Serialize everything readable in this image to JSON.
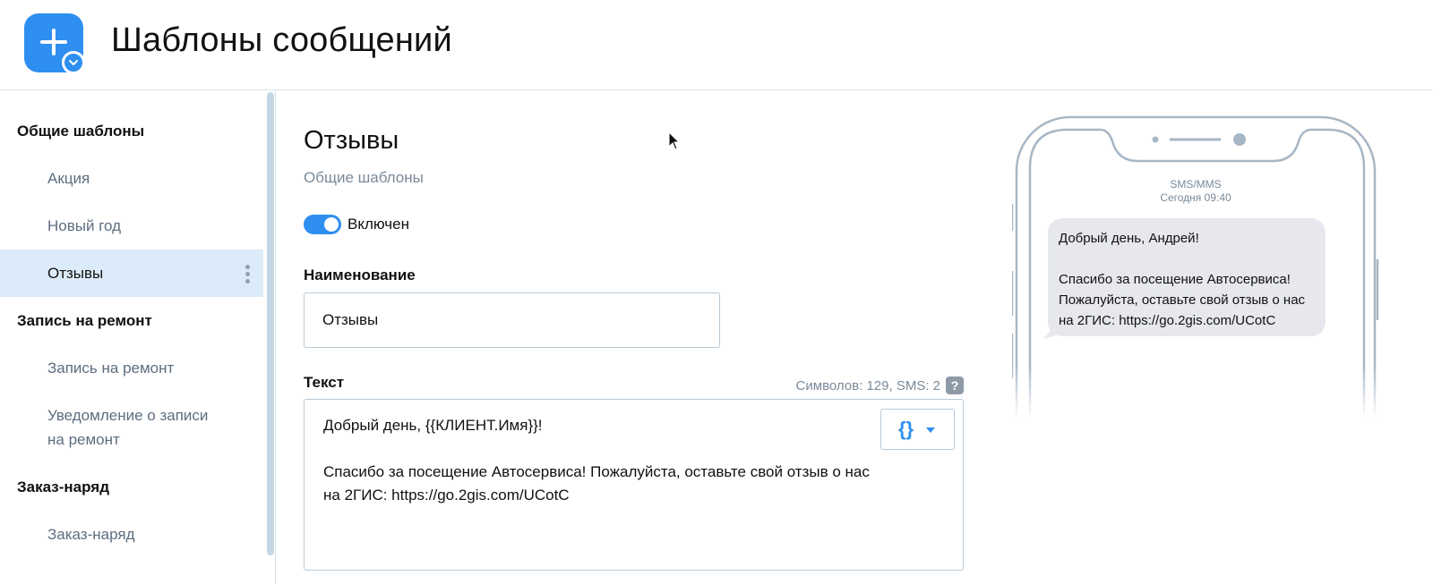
{
  "header": {
    "title": "Шаблоны сообщений",
    "icon": "add-template-icon",
    "accent_color": "#2f8ff0"
  },
  "sidebar": {
    "groups": [
      {
        "label": "Общие шаблоны",
        "items": [
          {
            "label": "Акция"
          },
          {
            "label": "Новый год"
          },
          {
            "label": "Отзывы",
            "active": true
          }
        ]
      },
      {
        "label": "Запись на ремонт",
        "items": [
          {
            "label": "Запись на ремонт"
          },
          {
            "label": "Уведомление о записи на ремонт"
          }
        ]
      },
      {
        "label": "Заказ-наряд",
        "items": [
          {
            "label": "Заказ-наряд"
          }
        ]
      }
    ]
  },
  "main": {
    "title": "Отзывы",
    "subtitle": "Общие шаблоны",
    "toggle": {
      "label": "Включен",
      "on": true
    },
    "name_label": "Наименование",
    "name_value": "Отзывы",
    "text_label": "Текст",
    "counter": "Символов: 129, SMS: 2",
    "help": "?",
    "text_value": "Добрый день, {{КЛИЕНТ.Имя}}!\n\nСпасибо за посещение Автосервиса! Пожалуйста, оставьте свой отзыв о нас на 2ГИС: https://go.2gis.com/UCotC",
    "variable_button": "{}"
  },
  "preview": {
    "channel": "SMS/MMS",
    "time": "Сегодня 09:40",
    "message": "Добрый день, Андрей!\n\nСпасибо за посещение Автосервиса! Пожалуйста, оставьте свой отзыв о нас на 2ГИС: https://go.2gis.com/UCotC"
  }
}
